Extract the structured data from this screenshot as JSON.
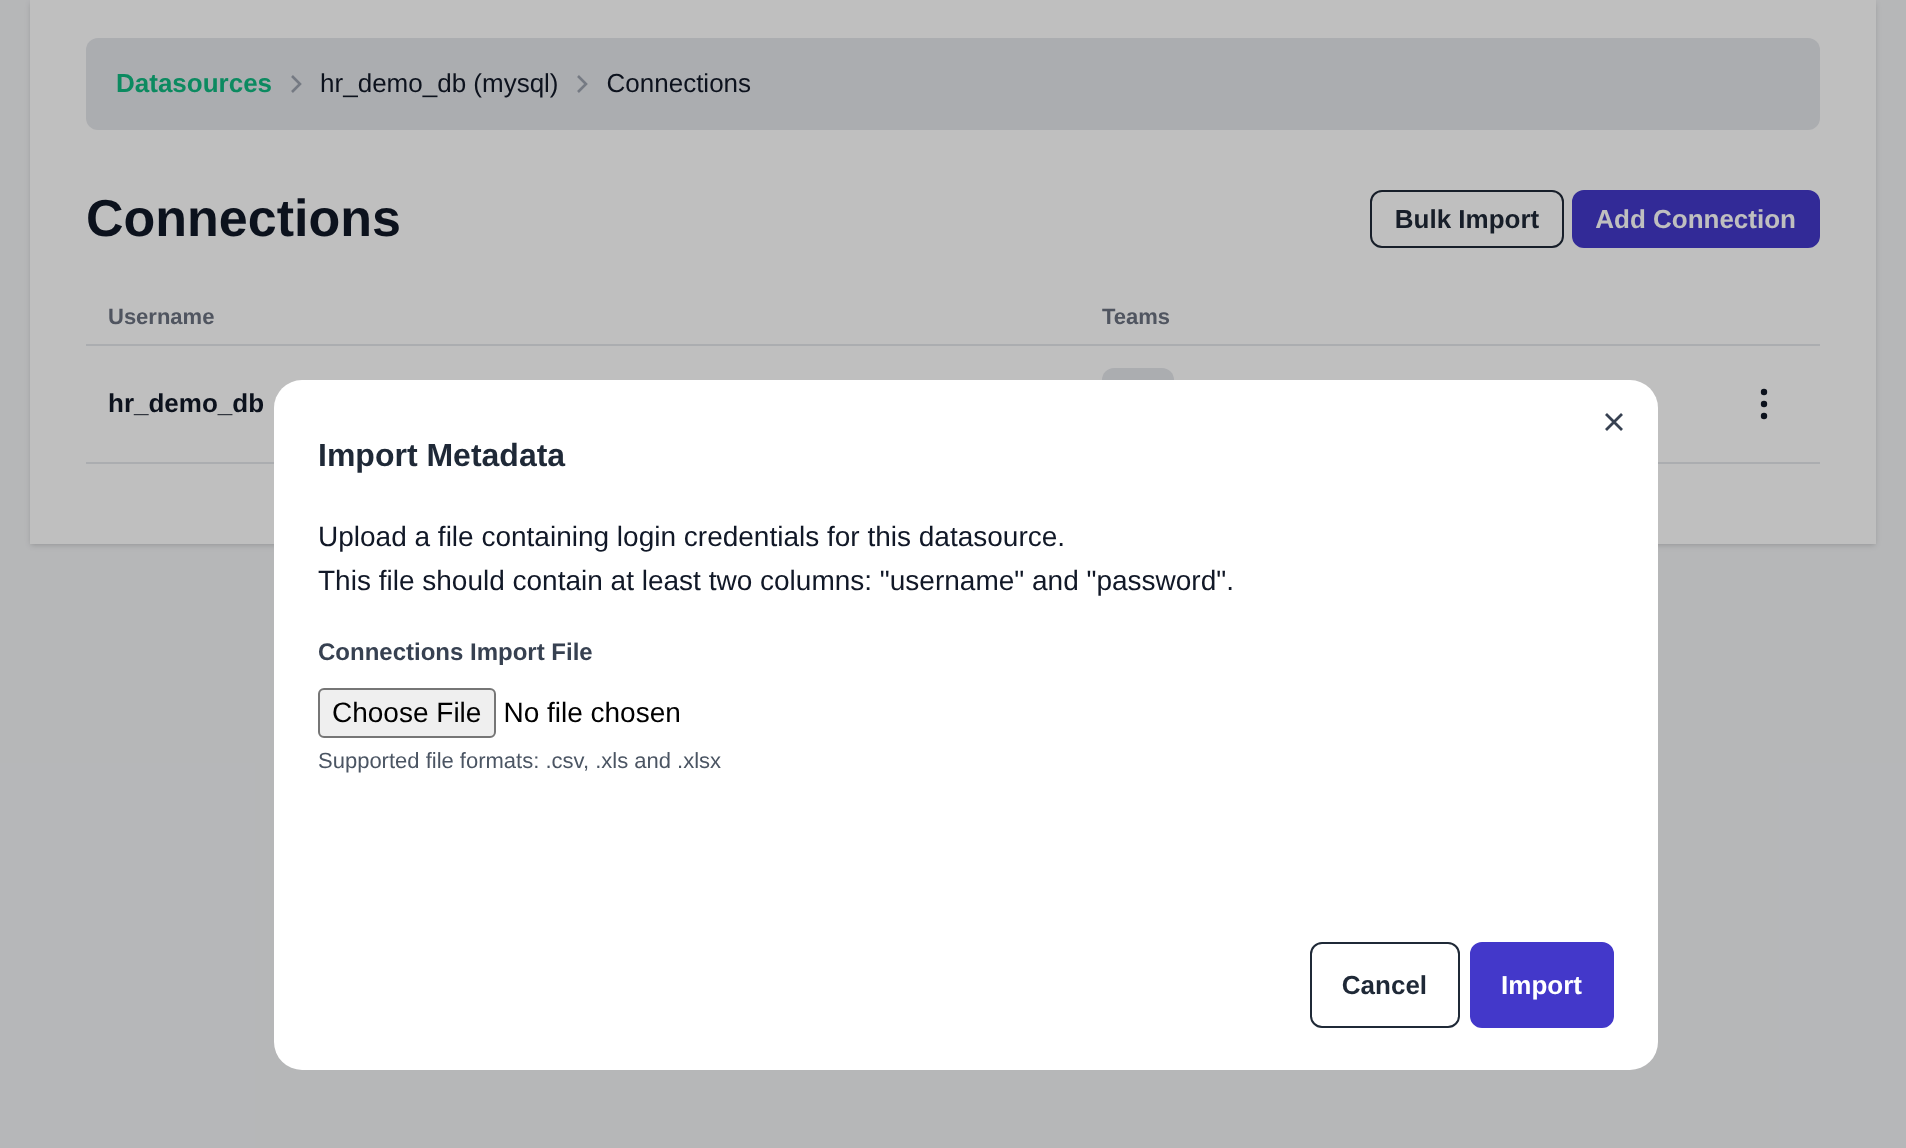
{
  "breadcrumbs": [
    {
      "label": "Datasources",
      "kind": "link"
    },
    {
      "label": "hr_demo_db (mysql)",
      "kind": "text"
    },
    {
      "label": "Connections",
      "kind": "text"
    }
  ],
  "page_title": "Connections",
  "header_buttons": [
    {
      "label": "Bulk Import",
      "kind": "outline"
    },
    {
      "label": "Add Connection",
      "kind": "primary"
    }
  ],
  "table": {
    "columns": [
      "Username",
      "Teams"
    ],
    "rows": [
      {
        "username": "hr_demo_db"
      }
    ]
  },
  "dialog": {
    "title": "Import Metadata",
    "description": [
      "Upload a file containing login credentials for this datasource.",
      "This file should contain at least two columns: \"username\" and \"password\"."
    ],
    "field_label": "Connections Import File",
    "file_button": "Choose File",
    "file_status": "No file chosen",
    "hint": "Supported file formats: .csv, .xls and .xlsx",
    "buttons": [
      {
        "label": "Cancel",
        "kind": "outline"
      },
      {
        "label": "Import",
        "kind": "primary"
      }
    ]
  }
}
